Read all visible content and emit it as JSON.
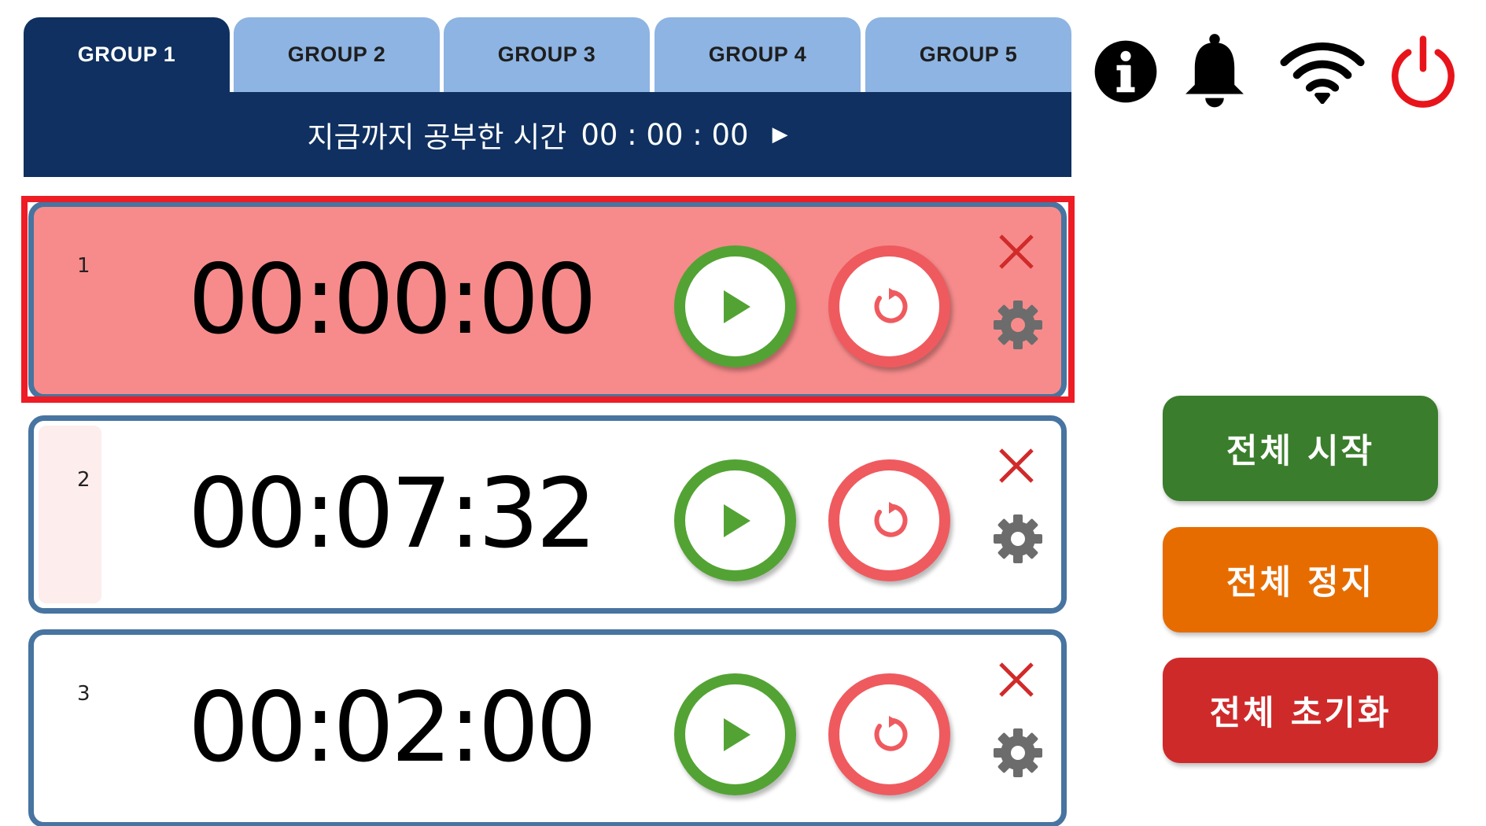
{
  "tabs": [
    {
      "label": "GROUP 1",
      "active": true
    },
    {
      "label": "GROUP 2",
      "active": false
    },
    {
      "label": "GROUP 3",
      "active": false
    },
    {
      "label": "GROUP 4",
      "active": false
    },
    {
      "label": "GROUP 5",
      "active": false
    }
  ],
  "study_bar": {
    "label": "지금까지 공부한 시간",
    "total_time": "00 : 00 : 00",
    "arrow": "▶"
  },
  "status_icons": [
    "info-icon",
    "bell-icon",
    "wifi-icon",
    "power-icon"
  ],
  "timers": [
    {
      "index": "1",
      "time": "00:00:00",
      "selected": true
    },
    {
      "index": "2",
      "time": "00:07:32",
      "selected": false
    },
    {
      "index": "3",
      "time": "00:02:00",
      "selected": false
    }
  ],
  "bulk_actions": {
    "start_all": "전체 시작",
    "stop_all": "전체 정지",
    "reset_all": "전체 초기화"
  },
  "colors": {
    "navy": "#0f3060",
    "tab_inactive": "#8db4e2",
    "card_border": "#4774a0",
    "selected_card": "#f78b8b",
    "selection_frame": "#ee1c24",
    "play_green": "#53a334",
    "reset_red": "#ef5a5f",
    "start_all": "#3a7d2c",
    "stop_all": "#e66c00",
    "reset_all": "#cf2a2a",
    "power_red": "#e8141b"
  }
}
